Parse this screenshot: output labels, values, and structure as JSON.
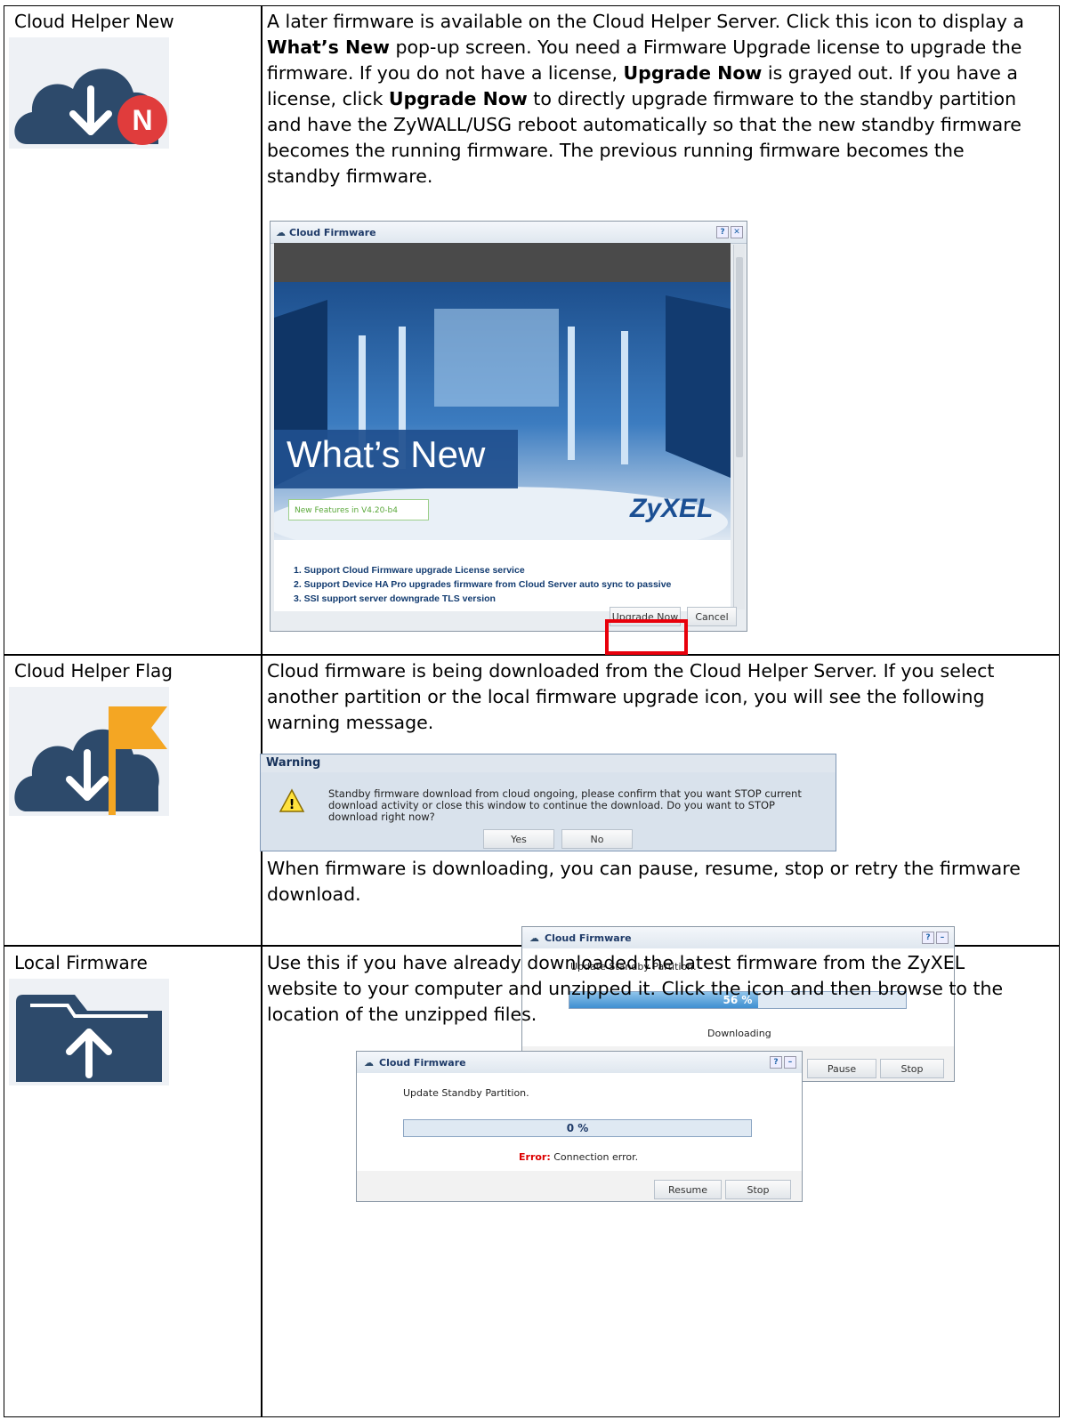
{
  "rows": [
    {
      "label": "Cloud Helper New",
      "icon": "cloud-download-new-icon",
      "desc": {
        "t1": "A later firmware is available on the Cloud Helper Server. Click this icon to display a ",
        "b1": "What’s New",
        "t2": " pop-up screen. You need a Firmware Upgrade license to upgrade the firmware. If you do not have a license, ",
        "b2": "Upgrade Now",
        "t3": " is grayed out. If you have a license, click ",
        "b3": "Upgrade Now",
        "t4": " to directly upgrade firmware to the standby partition and have the ZyWALL/USG reboot automatically so that the new standby firmware becomes the running firmware. The previous running firmware becomes the standby firmware."
      },
      "icon_badge": "N"
    },
    {
      "label": "Cloud Helper Flag",
      "icon": "cloud-download-flag-icon",
      "desc1": "Cloud firmware is being downloaded from the Cloud Helper Server. If you select another partition or the local firmware upgrade icon, you will see the following warning message.",
      "desc2": "When firmware is downloading, you can pause, resume, stop or retry the firmware download."
    },
    {
      "label": "Local Firmware",
      "icon": "folder-upload-icon",
      "desc": "Use this if you have already downloaded the latest firmware from the ZyXEL website to your computer and unzipped it. Click the icon and then browse to the location of the unzipped files."
    }
  ],
  "whats_new_dialog": {
    "title": "Cloud Firmware",
    "heading": "What’s New",
    "version_badge": "New Features in V4.20-b4",
    "brand": "ZyXEL",
    "items": [
      "1.  Support Cloud Firmware upgrade License service",
      "2.  Support Device HA Pro upgrades firmware from Cloud Server auto sync to passive",
      "3.  SSI support server downgrade TLS version"
    ],
    "upgrade_label": "Upgrade Now",
    "cancel_label": "Cancel"
  },
  "warning_dialog": {
    "title": "Warning",
    "message": "Standby firmware download from cloud ongoing, please confirm that you want STOP current download activity or close this window to continue the download. Do you want to STOP download right now?",
    "yes_label": "Yes",
    "no_label": "No"
  },
  "download_dialog": {
    "title": "Cloud Firmware",
    "text": "Update Standby Partition.",
    "percent": 56,
    "percent_label": "56 %",
    "status": "Downloading",
    "pause_label": "Pause",
    "stop_label": "Stop"
  },
  "error_dialog": {
    "title": "Cloud Firmware",
    "text": "Update Standby Partition.",
    "percent": 0,
    "percent_label": "0 %",
    "error_prefix": "Error:",
    "error_text": " Connection error.",
    "resume_label": "Resume",
    "stop_label": "Stop"
  },
  "colors": {
    "icon_navy": "#2d4a6b",
    "badge_red": "#e03c3c",
    "flag_orange": "#f4a623",
    "highlight_red": "#e8000b"
  }
}
